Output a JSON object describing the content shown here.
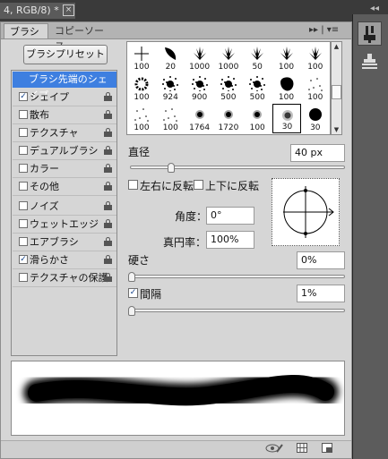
{
  "document_tab": {
    "title": "4, RGB/8) *",
    "close_glyph": "×"
  },
  "collapse_glyph": "◂◂",
  "panel_tabs": [
    {
      "label": "ブラシ"
    },
    {
      "label": "コピーソース"
    }
  ],
  "panel_menu_glyph": "▸▸ | ▾≡",
  "preset_button_label": "ブラシプリセット",
  "options": {
    "header": "ブラシ先端のシェイプ",
    "items": [
      {
        "label": "シェイプ",
        "checked": true,
        "check": "✓"
      },
      {
        "label": "散布",
        "checked": false,
        "check": ""
      },
      {
        "label": "テクスチャ",
        "checked": false,
        "check": ""
      },
      {
        "label": "デュアルブラシ",
        "checked": false,
        "check": ""
      },
      {
        "label": "カラー",
        "checked": false,
        "check": ""
      },
      {
        "label": "その他",
        "checked": false,
        "check": ""
      },
      {
        "label": "ノイズ",
        "checked": false,
        "check": ""
      },
      {
        "label": "ウェットエッジ",
        "checked": false,
        "check": ""
      },
      {
        "label": "エアブラシ",
        "checked": false,
        "check": ""
      },
      {
        "label": "滑らかさ",
        "checked": true,
        "check": "✓"
      },
      {
        "label": "テクスチャの保護",
        "checked": false,
        "check": ""
      }
    ]
  },
  "brushes": {
    "rows": [
      [
        {
          "n": "100",
          "icon": "cross-tip"
        },
        {
          "n": "20",
          "icon": "leaf-tip"
        },
        {
          "n": "1000",
          "icon": "grass-tip"
        },
        {
          "n": "1000",
          "icon": "grass-tip"
        },
        {
          "n": "50",
          "icon": "grass-tip"
        },
        {
          "n": "100",
          "icon": "grass-tip"
        },
        {
          "n": "100",
          "icon": "grass-tip"
        }
      ],
      [
        {
          "n": "100",
          "icon": "wreath-tip"
        },
        {
          "n": "924",
          "icon": "splatter-tip"
        },
        {
          "n": "900",
          "icon": "splatter-tip"
        },
        {
          "n": "500",
          "icon": "splatter-tip"
        },
        {
          "n": "500",
          "icon": "splatter-tip"
        },
        {
          "n": "100",
          "icon": "blob-tip"
        },
        {
          "n": "100",
          "icon": "dots-tip"
        }
      ],
      [
        {
          "n": "100",
          "icon": "dots-tip"
        },
        {
          "n": "100",
          "icon": "dots-tip"
        },
        {
          "n": "1764",
          "icon": "ring-tip"
        },
        {
          "n": "1720",
          "icon": "ring-tip"
        },
        {
          "n": "100",
          "icon": "ring-tip"
        },
        {
          "n": "30",
          "icon": "soft-round-tip"
        },
        {
          "n": "30",
          "icon": "hard-round-tip"
        }
      ]
    ],
    "selected_index": 19
  },
  "diameter": {
    "label": "直径",
    "value": "40 px",
    "level": 0.18
  },
  "flip_x": {
    "label": "左右に反転",
    "check": ""
  },
  "flip_y": {
    "label": "上下に反転",
    "check": ""
  },
  "angle": {
    "label": "角度：",
    "value": "0°"
  },
  "roundness": {
    "label": "真円率：",
    "value": "100%"
  },
  "hardness": {
    "label": "硬さ",
    "value": "0%",
    "level": 0.0
  },
  "spacing": {
    "label": "間隔",
    "value": "1%",
    "check": "✓",
    "level": 0.0
  },
  "colors": {
    "accent": "#3e7fe0",
    "panel": "#d6d6d6",
    "dock": "#5c5c5c"
  }
}
